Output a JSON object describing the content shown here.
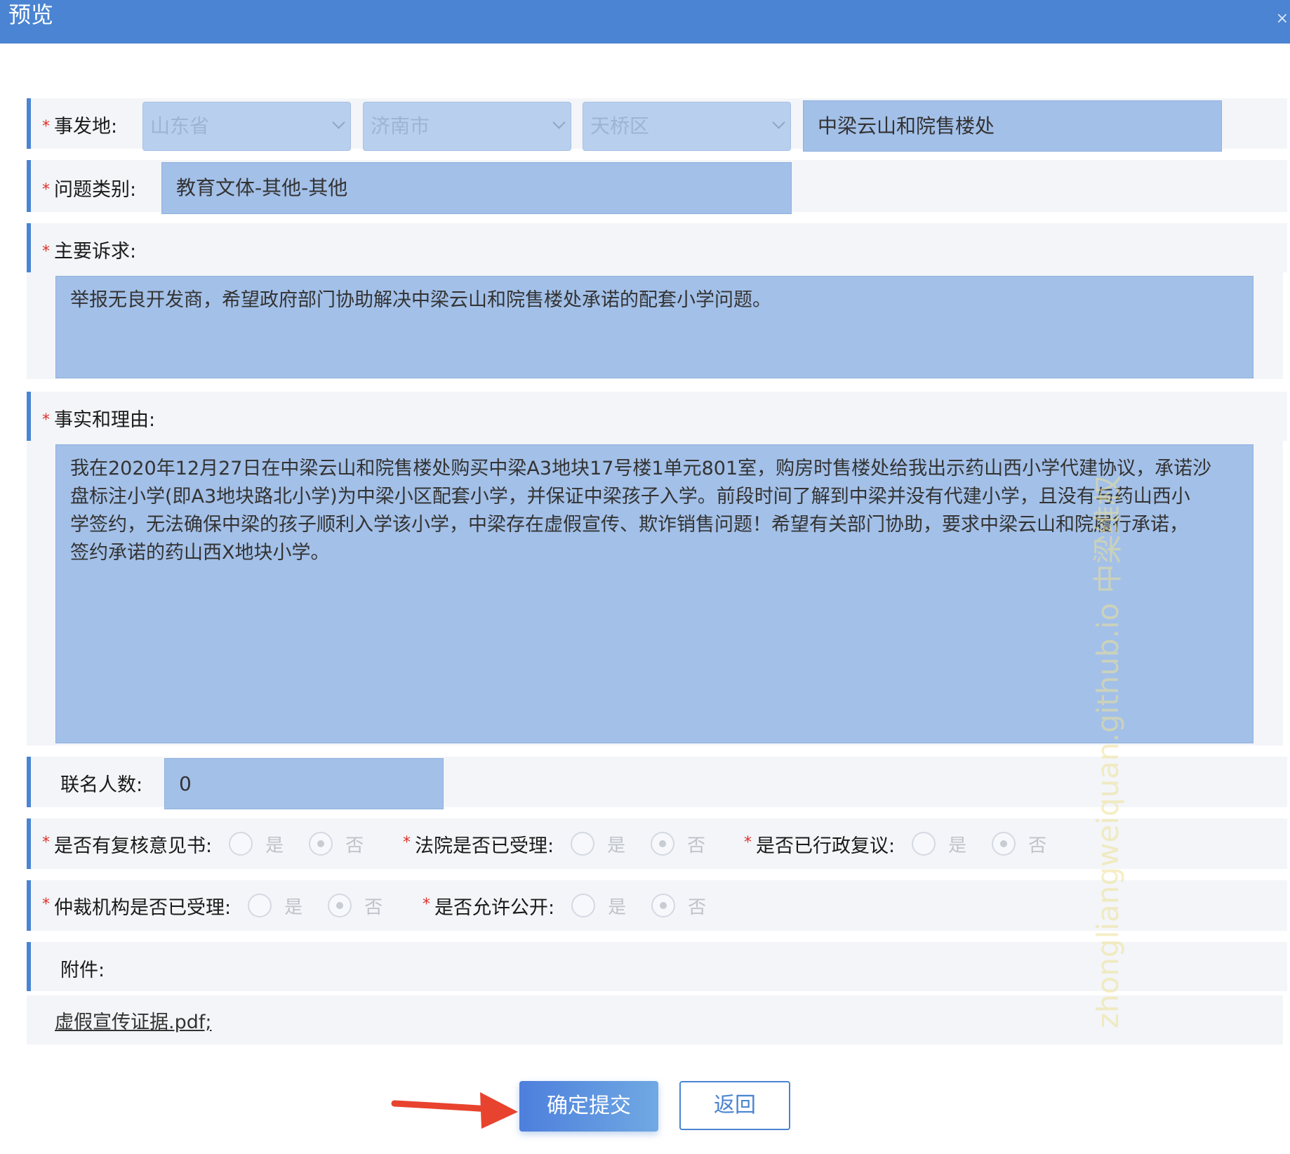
{
  "dialog": {
    "title": "预览",
    "close_icon": "close-icon"
  },
  "location": {
    "label": "事发地:",
    "province": "山东省",
    "city": "济南市",
    "district": "天桥区",
    "detail": "中梁云山和院售楼处"
  },
  "category": {
    "label": "问题类别:",
    "value": "教育文体-其他-其他"
  },
  "main_request": {
    "label": "主要诉求:",
    "value": "举报无良开发商，希望政府部门协助解决中梁云山和院售楼处承诺的配套小学问题。"
  },
  "facts": {
    "label": "事实和理由:",
    "lines": [
      "我在2020年12月27日在中梁云山和院售楼处购买中梁A3地块17号楼1单元801室，购房时售楼处给我出示药山西小学代建协议，承诺沙",
      "盘标注小学(即A3地块路北小学)为中梁小区配套小学，并保证中梁孩子入学。前段时间了解到中梁并没有代建小学，且没有与药山西小",
      "学签约，无法确保中梁的孩子顺利入学该小学，中梁存在虚假宣传、欺诈销售问题！希望有关部门协助，要求中梁云山和院履行承诺，",
      "签约承诺的药山西X地块小学。"
    ]
  },
  "cosigners": {
    "label": "联名人数:",
    "value": "0"
  },
  "radios": {
    "review_opinion": {
      "label": "是否有复核意见书:",
      "yes": "是",
      "no": "否",
      "selected": "否"
    },
    "court_accepted": {
      "label": "法院是否已受理:",
      "yes": "是",
      "no": "否",
      "selected": "否"
    },
    "admin_review": {
      "label": "是否已行政复议:",
      "yes": "是",
      "no": "否",
      "selected": "否"
    },
    "arbitration": {
      "label": "仲裁机构是否已受理:",
      "yes": "是",
      "no": "否",
      "selected": "否"
    },
    "public": {
      "label": "是否允许公开:",
      "yes": "是",
      "no": "否",
      "selected": "否"
    }
  },
  "attachments": {
    "label": "附件:",
    "file": "虚假宣传证据.pdf;"
  },
  "buttons": {
    "submit": "确定提交",
    "back": "返回"
  },
  "watermark": "zhongliangweiquan.github.io 中梁维权",
  "colors": {
    "header": "#4a84d2",
    "field": "#a3c0e8",
    "required": "#e0302a",
    "arrow": "#e8432e"
  }
}
